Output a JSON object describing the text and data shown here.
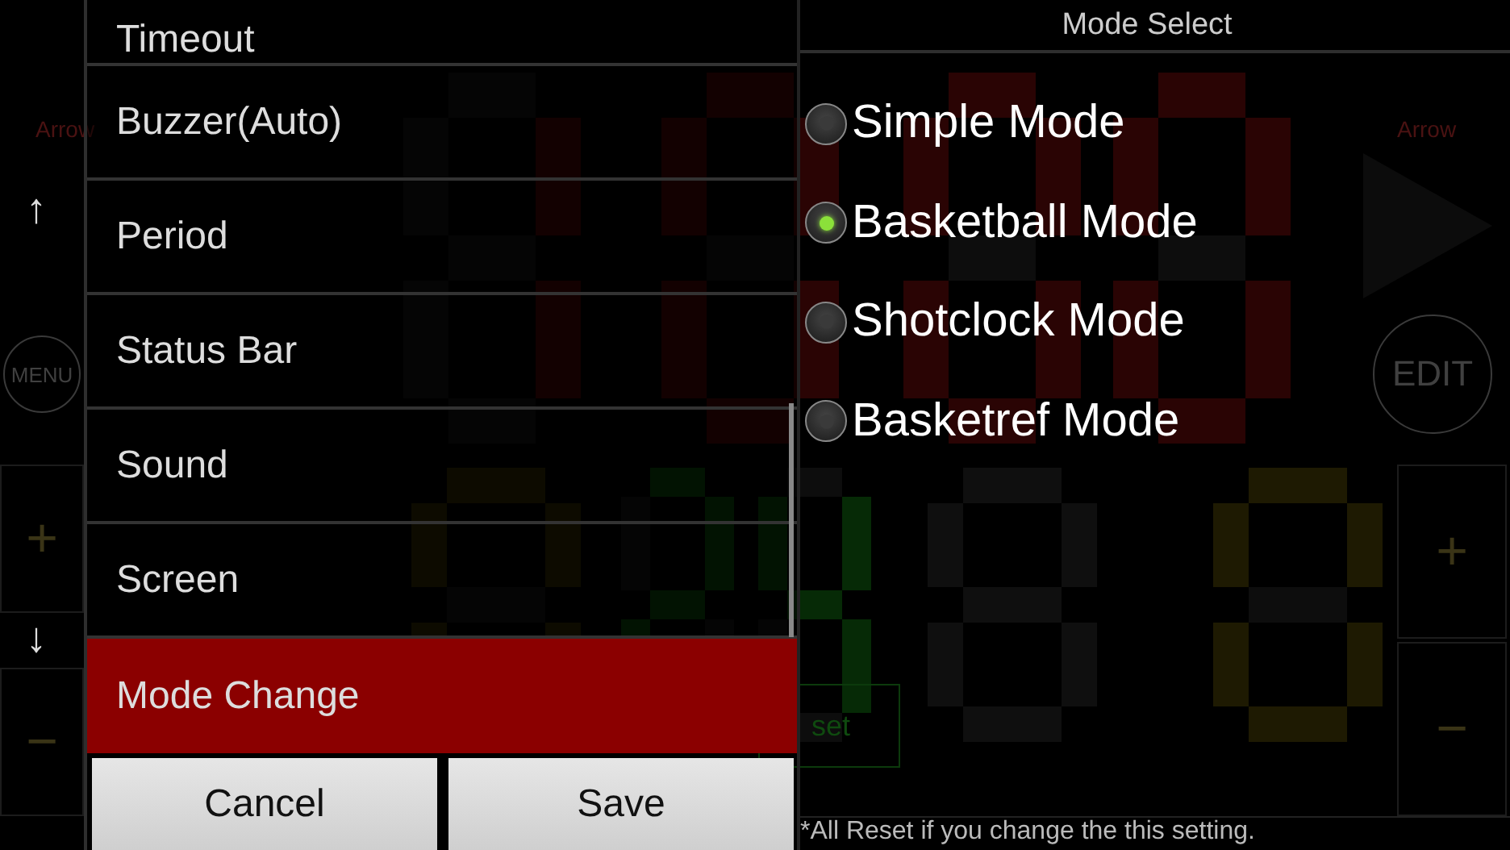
{
  "scoreboard": {
    "left_arrow_label": "Arrow",
    "right_arrow_label": "Arrow",
    "menu_button": "MENU",
    "edit_button": "EDIT",
    "left_plus": "+",
    "left_minus": "−",
    "right_plus": "+",
    "right_minus": "−",
    "reset_button": "set"
  },
  "side_column": {
    "up": "↑",
    "down": "↓"
  },
  "menu": {
    "items": [
      {
        "label": "Timeout",
        "selected": false
      },
      {
        "label": "Buzzer(Auto)",
        "selected": false
      },
      {
        "label": "Period",
        "selected": false
      },
      {
        "label": "Status Bar",
        "selected": false
      },
      {
        "label": "Sound",
        "selected": false
      },
      {
        "label": "Screen",
        "selected": false
      },
      {
        "label": "Mode Change",
        "selected": true
      }
    ],
    "buttons": [
      "Cancel",
      "Save"
    ]
  },
  "mode_select": {
    "title": "Mode Select",
    "options": [
      {
        "label": "Simple Mode",
        "selected": false
      },
      {
        "label": "Basketball Mode",
        "selected": true
      },
      {
        "label": "Shotclock Mode",
        "selected": false
      },
      {
        "label": "Basketref Mode",
        "selected": false
      }
    ],
    "note": "*All Reset if you change the this setting."
  }
}
